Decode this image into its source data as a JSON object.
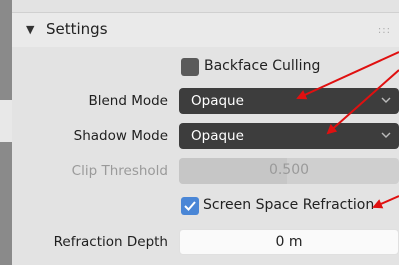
{
  "panel": {
    "title": "Settings",
    "grip": ":::"
  },
  "backface_culling": {
    "label": "Backface Culling",
    "checked": false
  },
  "blend_mode": {
    "label": "Blend Mode",
    "value": "Opaque"
  },
  "shadow_mode": {
    "label": "Shadow Mode",
    "value": "Opaque"
  },
  "clip_threshold": {
    "label": "Clip Threshold",
    "value": "0.500",
    "enabled": false,
    "fraction": 0.5
  },
  "screen_space_refraction": {
    "label": "Screen Space Refraction",
    "checked": true
  },
  "refraction_depth": {
    "label": "Refraction Depth",
    "value": "0 m"
  },
  "colors": {
    "annotation_arrow": "#e01010",
    "checkbox_checked": "#4a86d6",
    "dropdown_bg": "#3d3d3d"
  }
}
